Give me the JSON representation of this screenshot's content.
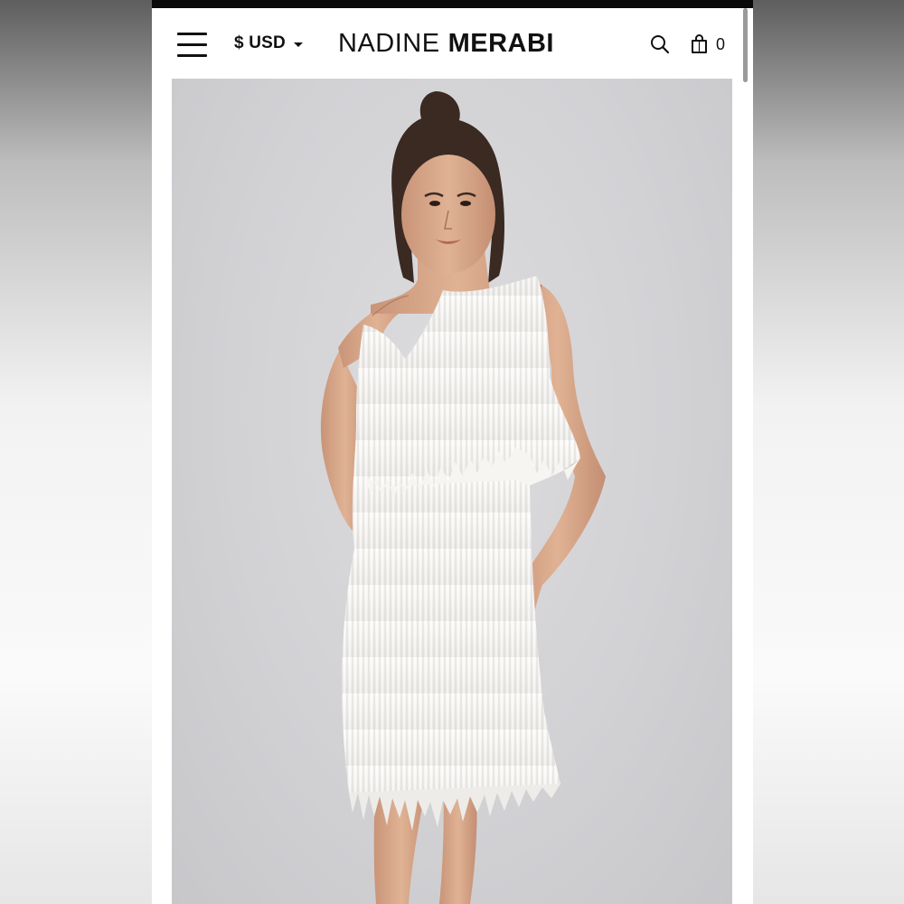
{
  "header": {
    "currency": "$ USD",
    "brand_light": "NADINE",
    "brand_bold": "MERABI",
    "cart_count": "0"
  },
  "icons": {
    "menu": "hamburger-menu-icon",
    "currency_dropdown": "chevron-down-icon",
    "search": "search-icon",
    "cart": "shopping-bag-icon"
  },
  "colors": {
    "text": "#111111",
    "image_background": "#d2d2d5",
    "dress": "#f4f3f1"
  }
}
